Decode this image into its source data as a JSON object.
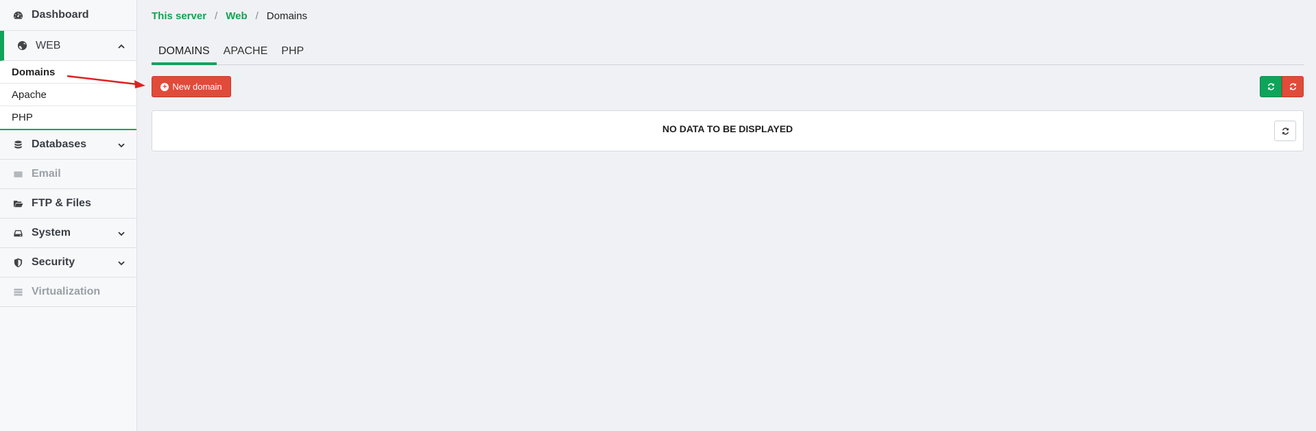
{
  "sidebar": {
    "items": [
      {
        "label": "Dashboard",
        "icon": "dashboard-icon"
      },
      {
        "label": "WEB",
        "icon": "globe-icon",
        "expanded": true,
        "subitems": [
          {
            "label": "Domains",
            "active": true
          },
          {
            "label": "Apache"
          },
          {
            "label": "PHP"
          }
        ]
      },
      {
        "label": "Databases",
        "icon": "database-icon"
      },
      {
        "label": "Email",
        "icon": "envelope-icon",
        "disabled": true
      },
      {
        "label": "FTP & Files",
        "icon": "folder-open-icon"
      },
      {
        "label": "System",
        "icon": "hdd-icon"
      },
      {
        "label": "Security",
        "icon": "shield-icon"
      },
      {
        "label": "Virtualization",
        "icon": "server-icon",
        "disabled": true
      }
    ]
  },
  "breadcrumb": {
    "items": [
      "This server",
      "Web",
      "Domains"
    ],
    "separator": "/"
  },
  "tabs": [
    {
      "label": "DOMAINS",
      "active": true
    },
    {
      "label": "APACHE"
    },
    {
      "label": "PHP"
    }
  ],
  "toolbar": {
    "new_domain_label": "New domain"
  },
  "panel": {
    "empty_text": "NO DATA TO BE DISPLAYED"
  },
  "colors": {
    "accent_green": "#0ea45a",
    "danger_red": "#e04b3a",
    "annotation_arrow": "#e02020"
  }
}
